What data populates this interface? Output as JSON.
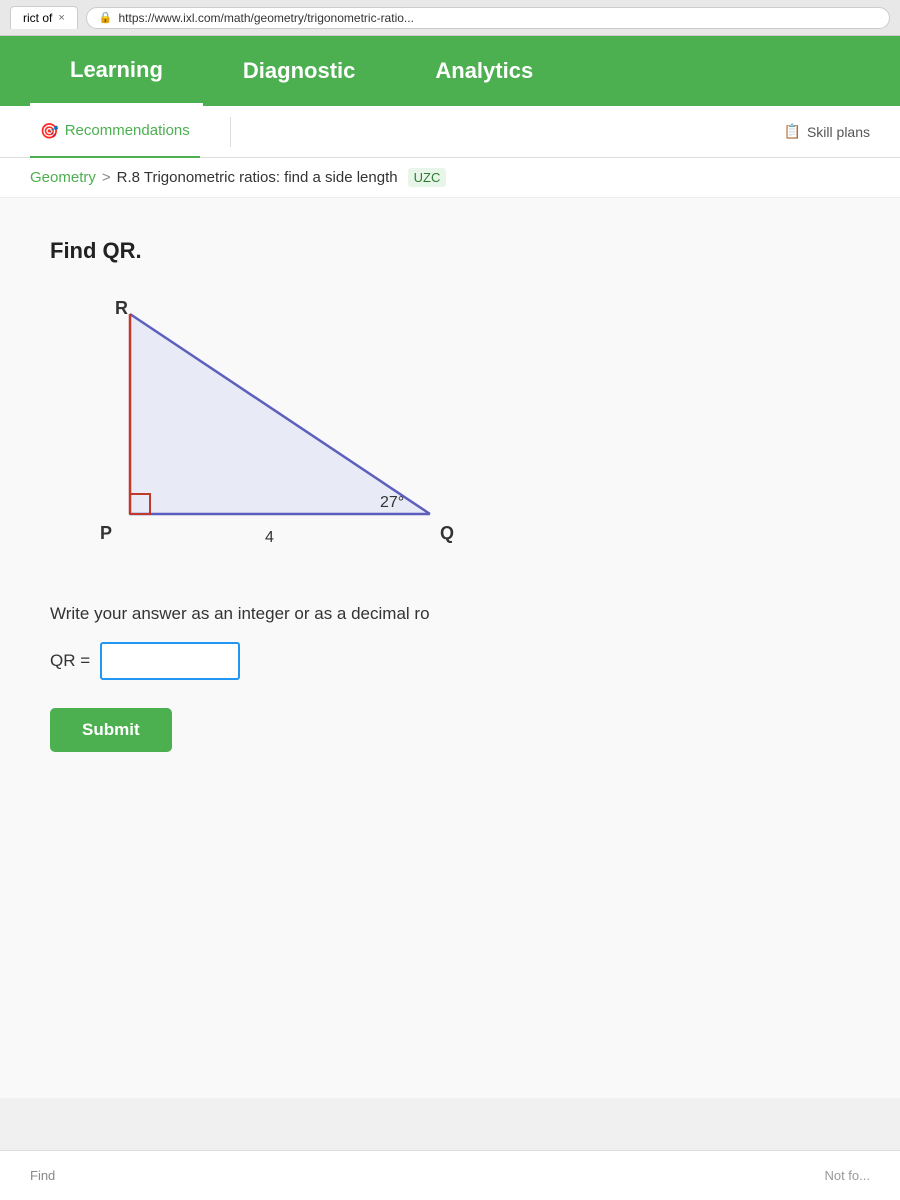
{
  "browser": {
    "tab_label": "rict of",
    "tab_close": "×",
    "url": "https://www.ixl.com/math/geometry/trigonometric-ratio...",
    "lock_icon": "🔒"
  },
  "nav": {
    "items": [
      {
        "id": "learning",
        "label": "Learning",
        "active": true
      },
      {
        "id": "diagnostic",
        "label": "Diagnostic",
        "active": false
      },
      {
        "id": "analytics",
        "label": "Analytics",
        "active": false
      }
    ]
  },
  "sub_nav": {
    "items": [
      {
        "id": "recommendations",
        "label": "Recommendations",
        "icon": "🎯",
        "active": true
      }
    ],
    "right": {
      "label": "Skill plans",
      "icon": "📋"
    }
  },
  "breadcrumb": {
    "parent": "Geometry",
    "chevron": ">",
    "current": "R.8 Trigonometric ratios: find a side length",
    "skill_code": "UZC"
  },
  "problem": {
    "title": "Find QR.",
    "triangle": {
      "vertices": {
        "R": "R",
        "P": "P",
        "Q": "Q"
      },
      "angle": "27°",
      "side_label": "4"
    },
    "instruction": "Write your answer as an integer or as a decimal ro",
    "answer_label": "QR =",
    "answer_placeholder": "",
    "submit_label": "Submit"
  },
  "bottom": {
    "links": [
      "Find"
    ],
    "right_text": "Not fo..."
  },
  "colors": {
    "green": "#4caf50",
    "blue_input": "#2196f3",
    "dark_green": "#2e7d32"
  }
}
